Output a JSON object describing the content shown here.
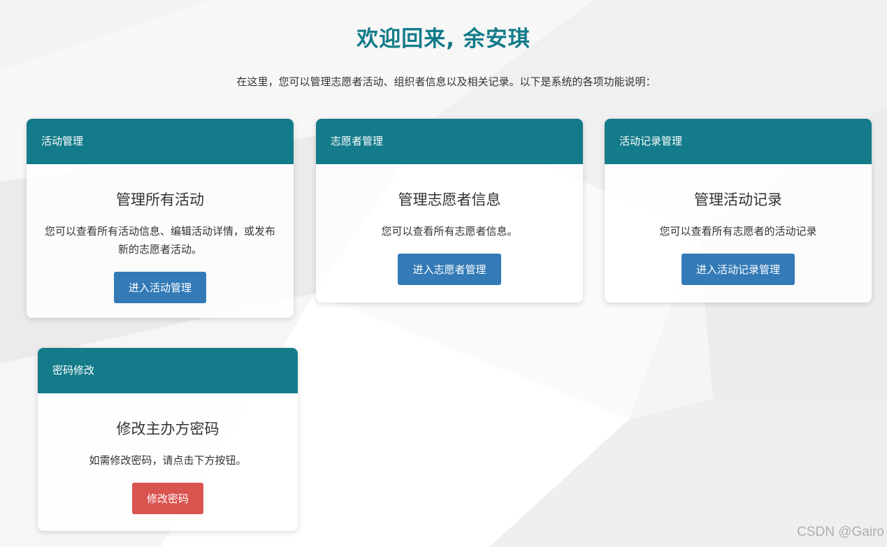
{
  "header": {
    "title": "欢迎回来, 余安琪",
    "intro": "在这里，您可以管理志愿者活动、组织者信息以及相关记录。以下是系统的各项功能说明："
  },
  "cards": [
    {
      "header": "活动管理",
      "title": "管理所有活动",
      "description": "您可以查看所有活动信息、编辑活动详情，或发布新的志愿者活动。",
      "button": "进入活动管理"
    },
    {
      "header": "志愿者管理",
      "title": "管理志愿者信息",
      "description": "您可以查看所有志愿者信息。",
      "button": "进入志愿者管理"
    },
    {
      "header": "活动记录管理",
      "title": "管理活动记录",
      "description": "您可以查看所有志愿者的活动记录",
      "button": "进入活动记录管理"
    },
    {
      "header": "密码修改",
      "title": "修改主办方密码",
      "description": "如需修改密码，请点击下方按钮。",
      "button": "修改密码"
    }
  ],
  "watermark": "CSDN @Gairo",
  "colors": {
    "accent": "#137b8a",
    "primary_button": "#337ab7",
    "danger_button": "#d9534f"
  }
}
